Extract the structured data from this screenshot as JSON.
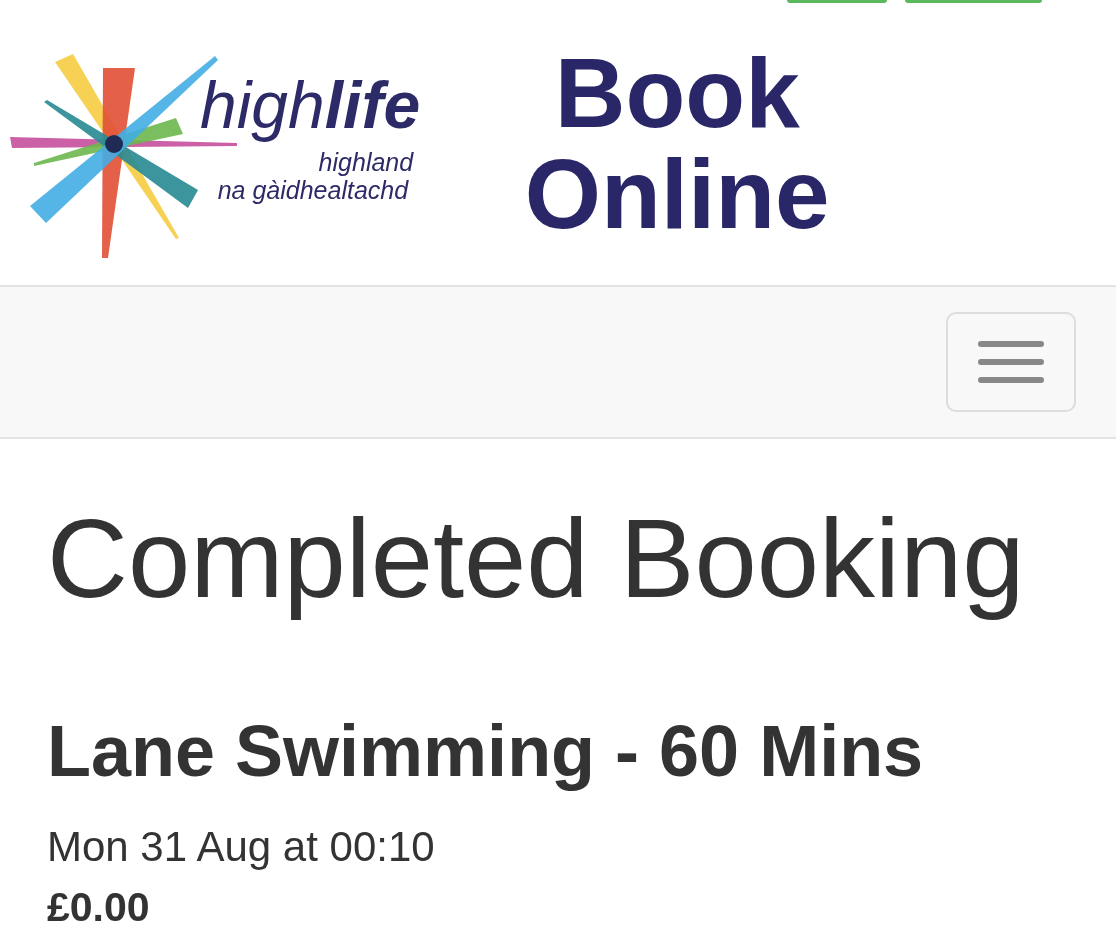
{
  "header": {
    "logo": {
      "name": "high**life**",
      "region": "highland",
      "region_gaelic": "na gàidhealtachd"
    },
    "title_lines": [
      "Book",
      "Online"
    ]
  },
  "page": {
    "title": "Completed Booking"
  },
  "booking": {
    "activity": "Lane Swimming - 60 Mins",
    "when": "Mon 31 Aug at 00:10",
    "price": "£0.00"
  }
}
